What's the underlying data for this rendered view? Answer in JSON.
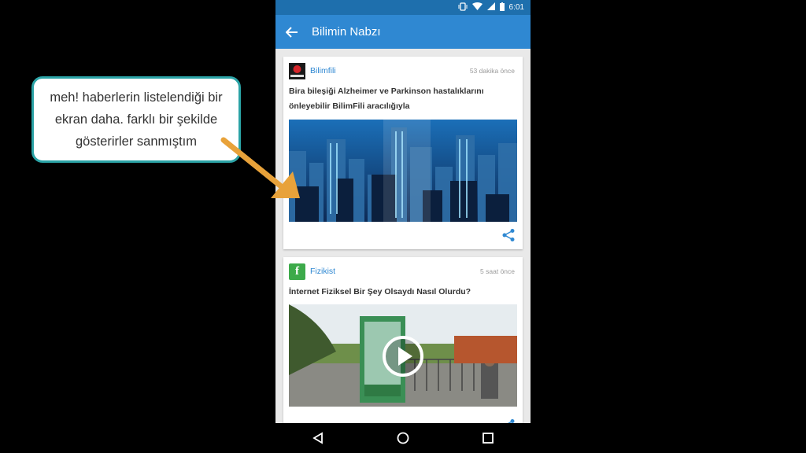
{
  "statusbar": {
    "time": "6:01"
  },
  "appbar": {
    "title": "Bilimin Nabzı"
  },
  "feed": [
    {
      "source": "Bilimfili",
      "logo_text": "BilimFili",
      "time": "53 dakika önce",
      "headline": "Bira bileşiği Alzheimer ve Parkinson hastalıklarını önleyebilir BilimFili aracılığıyla",
      "image": "city-skyline"
    },
    {
      "source": "Fizikist",
      "logo_text": "f",
      "time": "5 saat önce",
      "headline": "İnternet Fiziksel Bir Şey Olsaydı Nasıl Olurdu?",
      "image": "phone-booth-video"
    }
  ],
  "callout": {
    "text": "meh! haberlerin listelendiği bir ekran daha. farklı bir şekilde gösterirler sanmıştım"
  },
  "colors": {
    "appbar": "#2f88d2",
    "statusbar": "#1e6fad",
    "callout_border": "#2ba3a6",
    "arrow": "#e8a23a",
    "fizikist": "#3daa4a"
  },
  "icons": [
    "vibrate-icon",
    "wifi-icon",
    "signal-icon",
    "battery-icon",
    "back-arrow-icon",
    "share-icon",
    "play-icon",
    "nav-back-icon",
    "nav-home-icon",
    "nav-recents-icon"
  ]
}
